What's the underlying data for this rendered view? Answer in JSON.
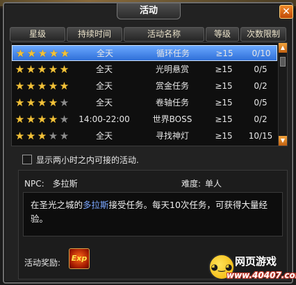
{
  "window": {
    "title": "活动",
    "close_icon": "✕"
  },
  "columns": [
    "星级",
    "持续时间",
    "活动名称",
    "等级",
    "次数限制"
  ],
  "rows": [
    {
      "stars": 5,
      "max_stars": 5,
      "time": "全天",
      "name": "循环任务",
      "level": "≥15",
      "count": "0/10",
      "selected": true
    },
    {
      "stars": 5,
      "max_stars": 5,
      "time": "全天",
      "name": "光明悬赏",
      "level": "≥15",
      "count": "0/5",
      "selected": false
    },
    {
      "stars": 5,
      "max_stars": 5,
      "time": "全天",
      "name": "赏金任务",
      "level": "≥15",
      "count": "0/2",
      "selected": false
    },
    {
      "stars": 4,
      "max_stars": 5,
      "time": "全天",
      "name": "卷轴任务",
      "level": "≥15",
      "count": "0/5",
      "selected": false
    },
    {
      "stars": 4,
      "max_stars": 5,
      "time": "14:00-22:00",
      "name": "世界BOSS",
      "level": "≥15",
      "count": "0/2",
      "selected": false
    },
    {
      "stars": 3,
      "max_stars": 5,
      "time": "全天",
      "name": "寻找神灯",
      "level": "≥15",
      "count": "10/15",
      "selected": false
    }
  ],
  "filter": {
    "label": "显示两小时之内可接的活动.",
    "checked": false
  },
  "info": {
    "npc_label": "NPC:",
    "npc_value": "多拉斯",
    "difficulty_label": "难度:",
    "difficulty_value": "单人",
    "desc_prefix": "在圣光之城的",
    "desc_npc": "多拉斯",
    "desc_suffix": "接受任务。每天10次任务，可获得大量经验。",
    "reward_label": "活动奖励:",
    "reward_icon_text": "Exp"
  },
  "watermark": {
    "title": "网页游戏",
    "url": "www.40407.com"
  },
  "colors": {
    "selected_row": "#2f6fd8",
    "star_full": "#f3c23a",
    "star_empty": "#8d8d8d",
    "npc_link": "#7aa6ff"
  }
}
